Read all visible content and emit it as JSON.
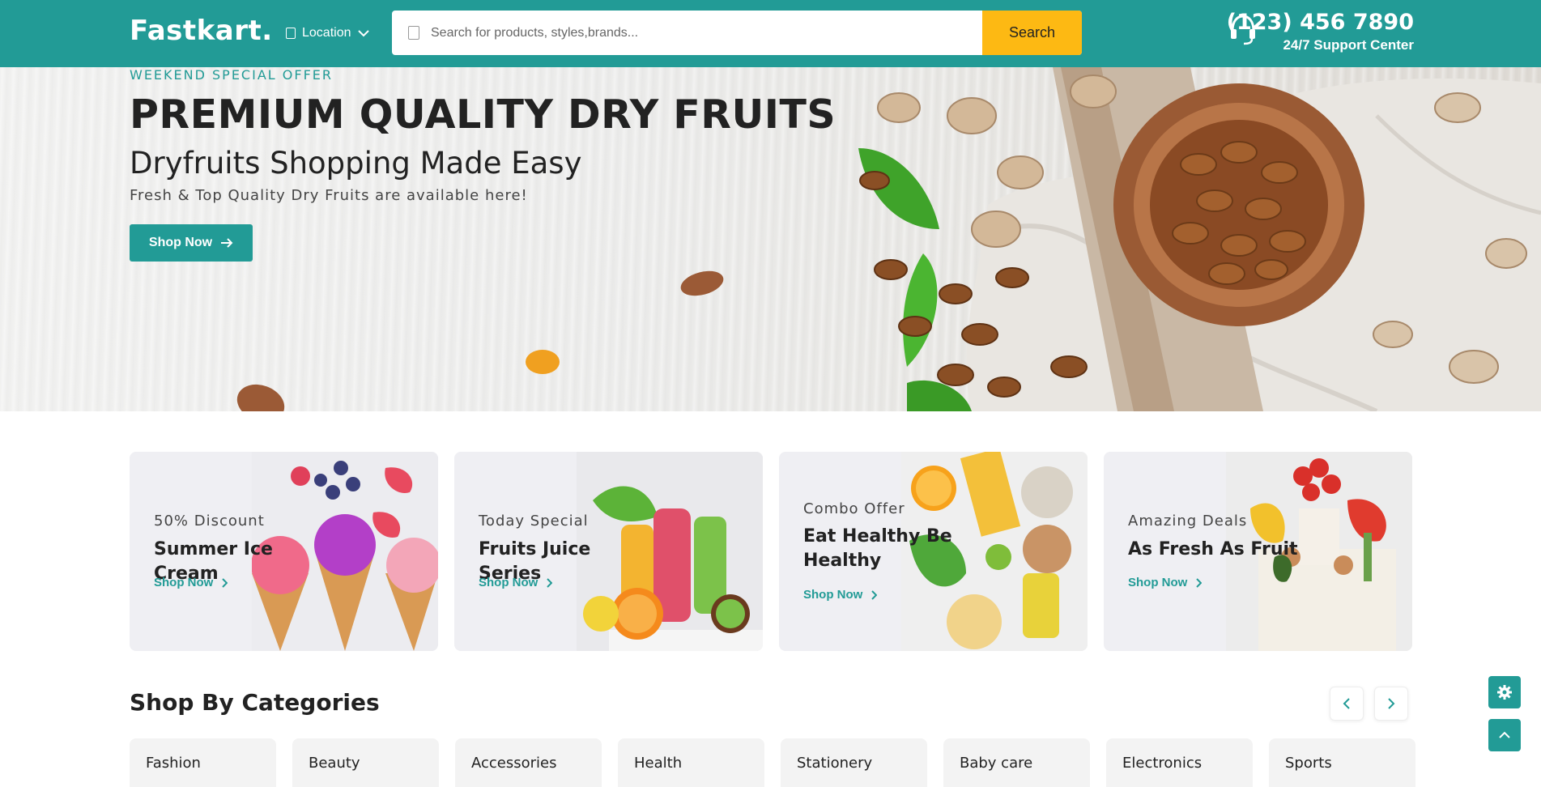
{
  "header": {
    "logo": "Fastkart.",
    "location_label": "Location",
    "search": {
      "placeholder": "Search for products, styles,brands...",
      "value": "",
      "button_label": "Search"
    },
    "support": {
      "phone": "(123) 456 7890",
      "subtitle": "24/7 Support Center"
    }
  },
  "hero": {
    "eyebrow": "WEEKEND SPECIAL OFFER",
    "title": "PREMIUM QUALITY DRY FRUITS",
    "subtitle": "Dryfruits Shopping Made Easy",
    "description": "Fresh & Top Quality Dry Fruits are available here!",
    "button_label": "Shop Now"
  },
  "promo_cards": [
    {
      "kicker": "50% Discount",
      "title": "Summer Ice Cream",
      "link": "Shop Now"
    },
    {
      "kicker": "Today Special",
      "title": "Fruits Juice Series",
      "link": "Shop Now"
    },
    {
      "kicker": "Combo Offer",
      "title": "Eat Healthy Be Healthy",
      "link": "Shop Now"
    },
    {
      "kicker": "Amazing Deals",
      "title": "As Fresh As Fruit",
      "link": "Shop Now"
    }
  ],
  "categories": {
    "title": "Shop By Categories",
    "items": [
      "Fashion",
      "Beauty",
      "Accessories",
      "Health",
      "Stationery",
      "Baby care",
      "Electronics",
      "Sports"
    ]
  },
  "icons": {
    "location_chevron": "chevron-down-icon",
    "support": "headset-icon",
    "hero_button": "arrow-right-icon",
    "card_link": "chevron-right-icon",
    "prev": "chevron-left-icon",
    "next": "chevron-right-icon",
    "settings": "gear-icon",
    "scroll_top": "chevron-up-icon"
  },
  "colors": {
    "brand": "#229b96",
    "accent": "#fdb913"
  }
}
